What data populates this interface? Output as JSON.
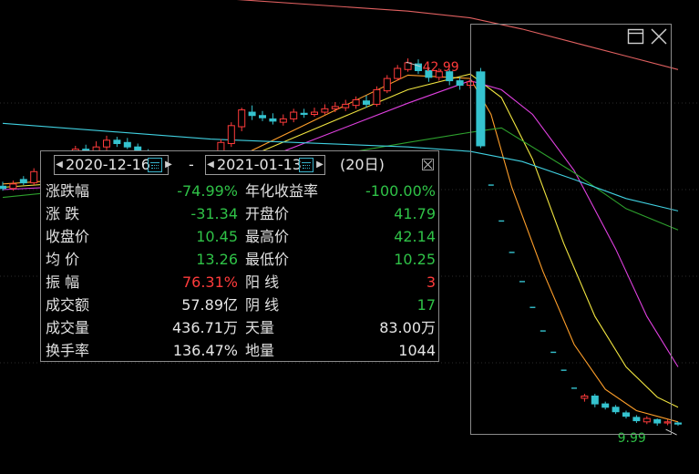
{
  "colors": {
    "up": "#ff3b3b",
    "down": "#2fc247",
    "candle_down_fill": "#35c3cf",
    "candle_up_fill": "#000000",
    "ma5": "#ff9f2a",
    "ma10": "#f2e640",
    "ma20": "#e040e0",
    "ma60": "#2da02d",
    "ma120": "#40d0e0",
    "ma250": "#e06060"
  },
  "window_icons": [
    "restore-icon",
    "close-icon"
  ],
  "chart_data": {
    "type": "candlestick",
    "title": "",
    "xlabel": "",
    "ylabel": "",
    "grid": true,
    "annotations": {
      "high_label": "42.99",
      "low_label": "9.99"
    },
    "selection": {
      "start_date": "2020-12-16",
      "end_date": "2021-01-13",
      "days": "(20日)"
    },
    "candles": [
      [
        31.6,
        31.4,
        32.0,
        31.2
      ],
      [
        31.4,
        31.8,
        32.1,
        31.2
      ],
      [
        32.2,
        31.9,
        32.5,
        31.7
      ],
      [
        31.9,
        32.9,
        33.2,
        31.7
      ],
      [
        32.8,
        33.9,
        34.1,
        32.6
      ],
      [
        34.0,
        33.2,
        34.4,
        32.9
      ],
      [
        33.2,
        34.4,
        34.7,
        33.0
      ],
      [
        34.3,
        34.9,
        35.2,
        34.0
      ],
      [
        34.9,
        34.5,
        35.3,
        34.2
      ],
      [
        34.5,
        35.1,
        35.6,
        34.3
      ],
      [
        35.1,
        35.7,
        36.1,
        34.8
      ],
      [
        35.7,
        35.4,
        36.0,
        35.1
      ],
      [
        35.5,
        35.1,
        35.9,
        34.9
      ],
      [
        35.1,
        34.6,
        35.4,
        34.2
      ],
      [
        34.6,
        34.0,
        34.9,
        33.6
      ],
      [
        34.0,
        33.5,
        34.3,
        33.2
      ],
      [
        33.5,
        33.0,
        33.8,
        32.7
      ],
      [
        33.0,
        32.5,
        33.3,
        32.2
      ],
      [
        32.4,
        31.9,
        32.8,
        31.6
      ],
      [
        31.8,
        32.7,
        33.1,
        31.5
      ],
      [
        32.8,
        34.1,
        34.4,
        32.5
      ],
      [
        34.0,
        35.5,
        35.8,
        33.8
      ],
      [
        35.4,
        37.0,
        37.3,
        35.1
      ],
      [
        36.9,
        38.4,
        38.6,
        36.5
      ],
      [
        38.2,
        37.9,
        38.8,
        37.5
      ],
      [
        37.9,
        37.7,
        38.3,
        37.4
      ],
      [
        37.6,
        37.4,
        38.1,
        37.1
      ],
      [
        37.3,
        37.6,
        38.0,
        37.0
      ],
      [
        37.6,
        38.2,
        38.5,
        37.3
      ],
      [
        38.1,
        38.0,
        38.5,
        37.7
      ],
      [
        38.0,
        38.2,
        38.6,
        37.8
      ],
      [
        38.2,
        38.5,
        38.9,
        38.0
      ],
      [
        38.5,
        38.7,
        39.1,
        38.2
      ],
      [
        38.6,
        38.9,
        39.3,
        38.3
      ],
      [
        38.8,
        39.3,
        39.6,
        38.5
      ],
      [
        39.2,
        38.9,
        39.7,
        38.6
      ],
      [
        38.9,
        40.2,
        40.5,
        38.7
      ],
      [
        40.1,
        41.2,
        41.5,
        39.9
      ],
      [
        41.2,
        42.1,
        42.4,
        41.0
      ],
      [
        42.0,
        42.6,
        42.99,
        41.8
      ],
      [
        42.5,
        41.9,
        42.9,
        41.6
      ],
      [
        41.9,
        41.3,
        42.2,
        40.9
      ],
      [
        41.3,
        41.8,
        42.1,
        41.0
      ],
      [
        41.8,
        41.0,
        42.0,
        40.6
      ],
      [
        41.0,
        40.6,
        41.3,
        40.2
      ],
      [
        40.6,
        40.9,
        41.2,
        40.3
      ],
      [
        41.79,
        35.2,
        42.14,
        35.0
      ],
      [
        31.7,
        31.7,
        31.7,
        31.7
      ],
      [
        28.5,
        28.5,
        28.5,
        28.5
      ],
      [
        25.7,
        25.7,
        25.7,
        25.7
      ],
      [
        23.1,
        23.1,
        23.1,
        23.1
      ],
      [
        20.8,
        20.8,
        20.8,
        20.8
      ],
      [
        18.7,
        18.7,
        18.7,
        18.7
      ],
      [
        16.8,
        16.8,
        16.8,
        16.8
      ],
      [
        15.2,
        15.2,
        15.2,
        15.2
      ],
      [
        13.6,
        13.6,
        13.6,
        13.6
      ],
      [
        12.7,
        12.9,
        13.1,
        12.4
      ],
      [
        12.9,
        12.2,
        13.1,
        11.9
      ],
      [
        12.2,
        11.9,
        12.4,
        11.7
      ],
      [
        11.9,
        11.5,
        12.1,
        11.3
      ],
      [
        11.4,
        11.1,
        11.6,
        10.9
      ],
      [
        11.0,
        10.7,
        11.2,
        10.5
      ],
      [
        10.6,
        10.9,
        11.1,
        10.4
      ],
      [
        10.8,
        10.5,
        10.9,
        10.25
      ],
      [
        10.5,
        10.6,
        10.8,
        10.3
      ],
      [
        10.5,
        10.45,
        10.6,
        10.25
      ]
    ],
    "moving_averages": [
      {
        "name": "MA5",
        "color": "#ff9f2a",
        "values": [
          [
            0,
            31.8
          ],
          [
            20,
            33.0
          ],
          [
            39,
            41.5
          ],
          [
            45,
            41.2
          ],
          [
            47,
            38.0
          ],
          [
            49,
            31.5
          ],
          [
            52,
            24.0
          ],
          [
            55,
            17.5
          ],
          [
            58,
            13.5
          ],
          [
            61,
            11.6
          ],
          [
            65,
            10.6
          ]
        ]
      },
      {
        "name": "MA10",
        "color": "#f2e640",
        "values": [
          [
            0,
            31.5
          ],
          [
            20,
            32.8
          ],
          [
            39,
            40.2
          ],
          [
            45,
            41.6
          ],
          [
            48,
            39.5
          ],
          [
            51,
            34.0
          ],
          [
            54,
            26.5
          ],
          [
            57,
            20.0
          ],
          [
            60,
            15.5
          ],
          [
            63,
            12.8
          ],
          [
            65,
            11.9
          ]
        ]
      },
      {
        "name": "MA20",
        "color": "#e040e0",
        "values": [
          [
            0,
            31.3
          ],
          [
            20,
            32.2
          ],
          [
            39,
            39.0
          ],
          [
            45,
            41.0
          ],
          [
            48,
            40.2
          ],
          [
            51,
            38.0
          ],
          [
            55,
            33.0
          ],
          [
            59,
            26.0
          ],
          [
            62,
            20.0
          ],
          [
            65,
            15.5
          ]
        ]
      },
      {
        "name": "MA60",
        "color": "#2da02d",
        "values": [
          [
            0,
            30.6
          ],
          [
            20,
            32.5
          ],
          [
            39,
            35.5
          ],
          [
            45,
            36.4
          ],
          [
            48,
            36.8
          ],
          [
            55,
            32.8
          ],
          [
            60,
            29.6
          ],
          [
            65,
            27.7
          ]
        ]
      },
      {
        "name": "MA120",
        "color": "#40d0e0",
        "values": [
          [
            0,
            37.2
          ],
          [
            20,
            35.8
          ],
          [
            39,
            35.1
          ],
          [
            45,
            34.7
          ],
          [
            50,
            33.8
          ],
          [
            55,
            32.2
          ],
          [
            60,
            30.5
          ],
          [
            65,
            29.4
          ]
        ]
      },
      {
        "name": "MA250",
        "color": "#e06060",
        "values": [
          [
            0,
            49.6
          ],
          [
            20,
            48.4
          ],
          [
            39,
            47.2
          ],
          [
            45,
            46.6
          ],
          [
            50,
            45.6
          ],
          [
            55,
            44.4
          ],
          [
            60,
            43.2
          ],
          [
            65,
            42.0
          ]
        ]
      }
    ]
  },
  "panel": {
    "start_date": "2020-12-16",
    "end_date": "2021-01-13",
    "dash": "-",
    "days": "(20日)",
    "rows": [
      {
        "l1": "涨跌幅",
        "v1": "-74.99%",
        "c1": "green",
        "l2": "年化收益率",
        "v2": "-100.00%",
        "c2": "green"
      },
      {
        "l1": "涨 跌",
        "v1": "-31.34",
        "c1": "green",
        "l2": "开盘价",
        "v2": "41.79",
        "c2": "green"
      },
      {
        "l1": "收盘价",
        "v1": "10.45",
        "c1": "green",
        "l2": "最高价",
        "v2": "42.14",
        "c2": "green"
      },
      {
        "l1": "均 价",
        "v1": "13.26",
        "c1": "green",
        "l2": "最低价",
        "v2": "10.25",
        "c2": "green"
      },
      {
        "l1": "振 幅",
        "v1": "76.31%",
        "c1": "red",
        "l2": "阳 线",
        "v2": "3",
        "c2": "red"
      },
      {
        "l1": "成交额",
        "v1": "57.89亿",
        "c1": "white",
        "l2": "阴 线",
        "v2": "17",
        "c2": "green"
      },
      {
        "l1": "成交量",
        "v1": "436.71万",
        "c1": "white",
        "l2": "天量",
        "v2": "83.00万",
        "c2": "white"
      },
      {
        "l1": "换手率",
        "v1": "136.47%",
        "c1": "white",
        "l2": "地量",
        "v2": "1044",
        "c2": "white"
      }
    ]
  }
}
